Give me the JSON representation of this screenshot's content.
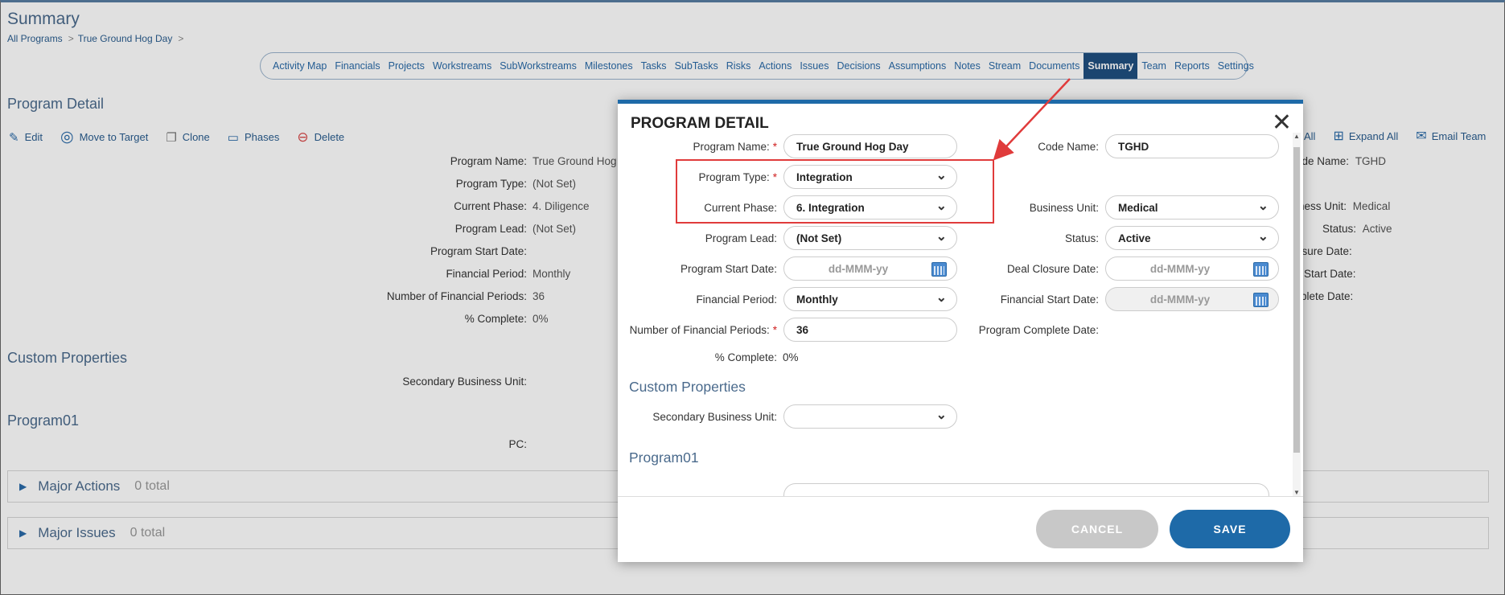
{
  "page": {
    "title": "Summary",
    "breadcrumb": [
      "All Programs",
      "True Ground Hog Day"
    ]
  },
  "nav": {
    "tabs": [
      "Activity Map",
      "Financials",
      "Projects",
      "Workstreams",
      "SubWorkstreams",
      "Milestones",
      "Tasks",
      "SubTasks",
      "Risks",
      "Actions",
      "Issues",
      "Decisions",
      "Assumptions",
      "Notes",
      "Stream",
      "Documents",
      "Summary",
      "Team",
      "Reports",
      "Settings"
    ],
    "active": "Summary"
  },
  "background": {
    "section_title": "Program Detail",
    "toolbar": {
      "edit": "Edit",
      "move": "Move to Target",
      "clone": "Clone",
      "phases": "Phases",
      "delete": "Delete"
    },
    "right_toolbar": {
      "collapse_all": "All",
      "expand_all": "Expand All",
      "email_team": "Email Team"
    },
    "fields": [
      {
        "label": "Program Name:",
        "value": "True Ground Hog"
      },
      {
        "label": "Program Type:",
        "value": "(Not Set)"
      },
      {
        "label": "Current Phase:",
        "value": "4. Diligence"
      },
      {
        "label": "Program Lead:",
        "value": "(Not Set)"
      },
      {
        "label": "Program Start Date:",
        "value": ""
      },
      {
        "label": "Financial Period:",
        "value": "Monthly"
      },
      {
        "label": "Number of Financial Periods:",
        "value": "36"
      },
      {
        "label": "% Complete:",
        "value": "0%"
      }
    ],
    "right_fields": [
      {
        "label": "ode Name:",
        "value": "TGHD"
      },
      {
        "label": "iness Unit:",
        "value": "Medical"
      },
      {
        "label": "Status:",
        "value": "Active"
      },
      {
        "label": "osure Date:",
        "value": ""
      },
      {
        "label": "Start Date:",
        "value": ""
      },
      {
        "label": "plete Date:",
        "value": ""
      }
    ],
    "custom_properties_title": "Custom Properties",
    "secondary_bu_label": "Secondary Business Unit:",
    "program01_title": "Program01",
    "pc_label": "PC:",
    "major_actions": {
      "title": "Major Actions",
      "count": "0 total"
    },
    "major_issues": {
      "title": "Major Issues",
      "count": "0 total"
    }
  },
  "modal": {
    "title": "PROGRAM DETAIL",
    "program_name": {
      "label": "Program Name:",
      "value": "True Ground Hog Day"
    },
    "code_name": {
      "label": "Code Name:",
      "value": "TGHD"
    },
    "program_type": {
      "label": "Program Type:",
      "value": "Integration"
    },
    "current_phase": {
      "label": "Current Phase:",
      "value": "6. Integration"
    },
    "business_unit": {
      "label": "Business Unit:",
      "value": "Medical"
    },
    "program_lead": {
      "label": "Program Lead:",
      "value": "(Not Set)"
    },
    "status": {
      "label": "Status:",
      "value": "Active"
    },
    "program_start_date": {
      "label": "Program Start Date:",
      "placeholder": "dd-MMM-yy"
    },
    "deal_closure_date": {
      "label": "Deal Closure Date:",
      "placeholder": "dd-MMM-yy"
    },
    "financial_period": {
      "label": "Financial Period:",
      "value": "Monthly"
    },
    "financial_start_date": {
      "label": "Financial Start Date:",
      "placeholder": "dd-MMM-yy"
    },
    "num_financial_periods": {
      "label": "Number of Financial Periods:",
      "value": "36"
    },
    "program_complete_date": {
      "label": "Program Complete Date:"
    },
    "percent_complete": {
      "label": "% Complete:",
      "value": "0%"
    },
    "custom_properties_title": "Custom Properties",
    "secondary_bu": {
      "label": "Secondary Business Unit:",
      "value": ""
    },
    "program01_title": "Program01",
    "cancel_label": "CANCEL",
    "save_label": "SAVE"
  },
  "colors": {
    "accent": "#1e6aa8",
    "highlight": "#e03b3b",
    "active_tab": "#1f4f80"
  }
}
